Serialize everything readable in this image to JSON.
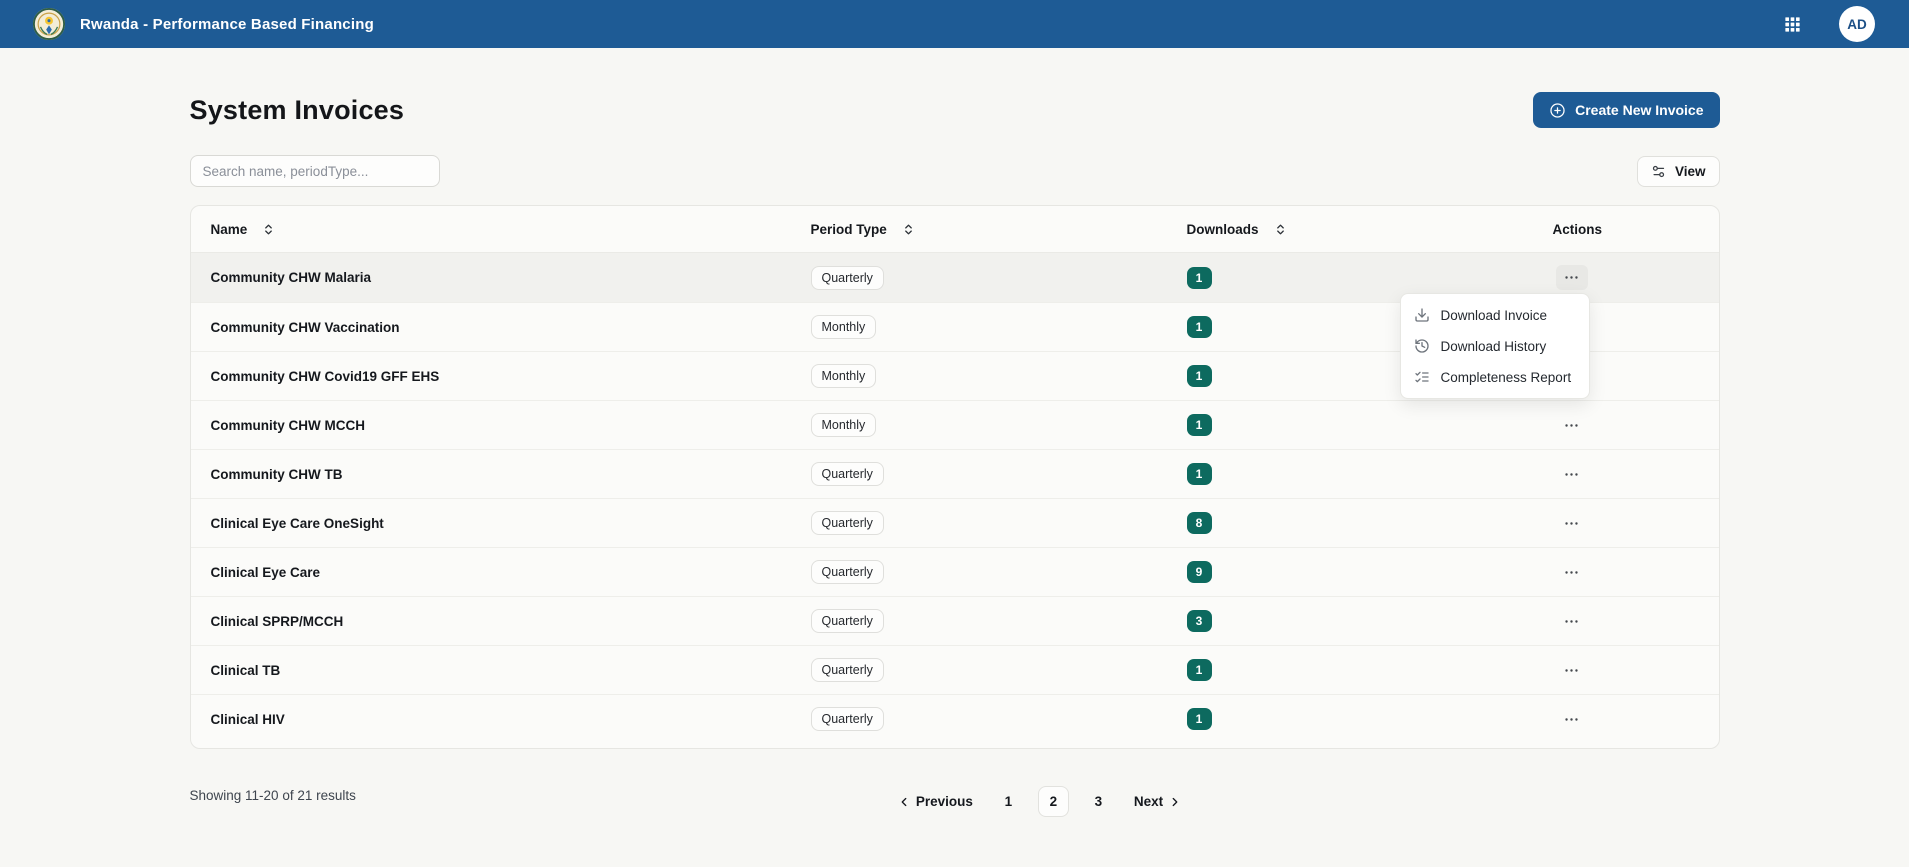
{
  "navbar": {
    "title": "Rwanda - Performance Based Financing",
    "logo_icon": "rwanda-emblem-logo",
    "apps_icon": "grid-icon",
    "avatar_initials": "AD"
  },
  "page": {
    "title": "System Invoices",
    "create_button_label": "Create New Invoice",
    "create_button_icon": "plus-circle-icon",
    "search_placeholder": "Search name, periodType...",
    "view_button_label": "View",
    "view_button_icon": "sliders-icon"
  },
  "table": {
    "columns": [
      {
        "label": "Name",
        "sortable": true,
        "sort_icon": "chevrons-up-down-icon"
      },
      {
        "label": "Period Type",
        "sortable": true,
        "sort_icon": "chevrons-up-down-icon"
      },
      {
        "label": "Downloads",
        "sortable": true,
        "sort_icon": "chevrons-up-down-icon"
      },
      {
        "label": "Actions",
        "sortable": false
      }
    ],
    "row_actions_icon": "ellipsis-icon",
    "rows": [
      {
        "name": "Community CHW Malaria",
        "period_type": "Quarterly",
        "downloads": "1",
        "highlighted": true
      },
      {
        "name": "Community CHW Vaccination",
        "period_type": "Monthly",
        "downloads": "1"
      },
      {
        "name": "Community CHW Covid19 GFF EHS",
        "period_type": "Monthly",
        "downloads": "1"
      },
      {
        "name": "Community CHW MCCH",
        "period_type": "Monthly",
        "downloads": "1"
      },
      {
        "name": "Community CHW TB",
        "period_type": "Quarterly",
        "downloads": "1"
      },
      {
        "name": "Clinical Eye Care OneSight",
        "period_type": "Quarterly",
        "downloads": "8"
      },
      {
        "name": "Clinical Eye Care",
        "period_type": "Quarterly",
        "downloads": "9"
      },
      {
        "name": "Clinical SPRP/MCCH",
        "period_type": "Quarterly",
        "downloads": "3"
      },
      {
        "name": "Clinical TB",
        "period_type": "Quarterly",
        "downloads": "1"
      },
      {
        "name": "Clinical HIV",
        "period_type": "Quarterly",
        "downloads": "1"
      }
    ]
  },
  "menu": {
    "items": [
      {
        "label": "Download Invoice",
        "icon": "download-icon"
      },
      {
        "label": "Download History",
        "icon": "history-icon"
      },
      {
        "label": "Completeness Report",
        "icon": "list-checks-icon"
      }
    ]
  },
  "pagination": {
    "showing_text": "Showing 11-20 of 21 results",
    "previous_label": "Previous",
    "next_label": "Next",
    "pages": [
      "1",
      "2",
      "3"
    ],
    "current_page": "2"
  },
  "colors": {
    "navbar_bg": "#1e5b95",
    "accent": "#1e5b95",
    "downloads_badge_bg": "#0d6a5f",
    "page_bg": "#f7f7f4",
    "card_bg": "#fbfbf9",
    "row_highlight": "#f1f1ee"
  }
}
